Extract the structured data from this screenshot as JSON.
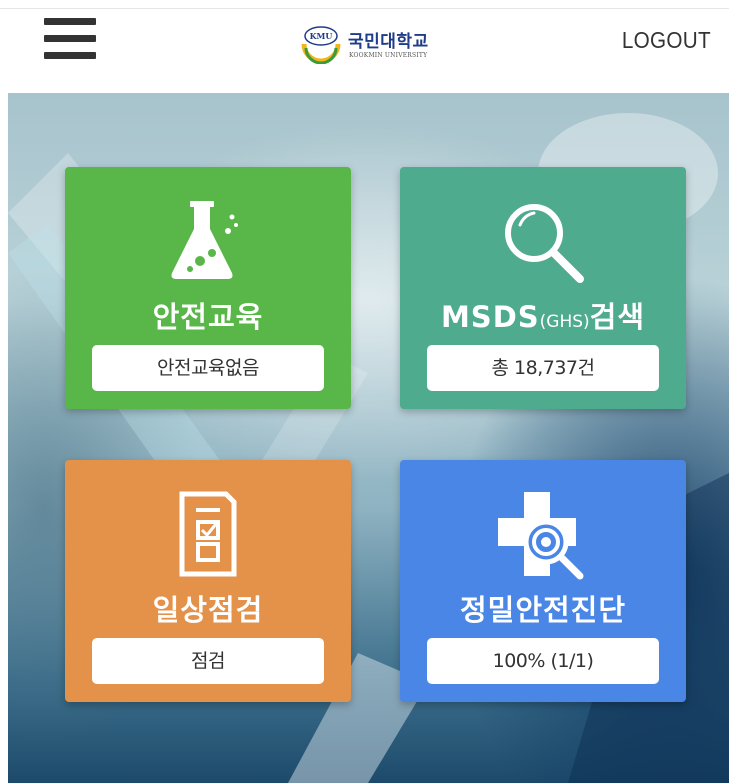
{
  "header": {
    "logo_badge": "KMU",
    "logo_name": "국민대학교",
    "logo_sub": "KOOKMIN UNIVERSITY",
    "logout_label": "LOGOUT"
  },
  "cards": {
    "safety_education": {
      "title": "안전교육",
      "status": "안전교육없음",
      "icon": "flask-icon",
      "color": "#59b648"
    },
    "msds_search": {
      "title": "MSDS",
      "title_suffix": "(GHS)",
      "title_tail": "검색",
      "status": "총 18,737건",
      "icon": "magnifier-icon",
      "color": "#4eab8d"
    },
    "daily_inspection": {
      "title": "일상점검",
      "status": "점검",
      "icon": "checklist-icon",
      "color": "#e4924a"
    },
    "safety_diagnosis": {
      "title": "정밀안전진단",
      "status": "100% (1/1)",
      "icon": "medical-cross-search-icon",
      "color": "#4a86e6"
    }
  }
}
